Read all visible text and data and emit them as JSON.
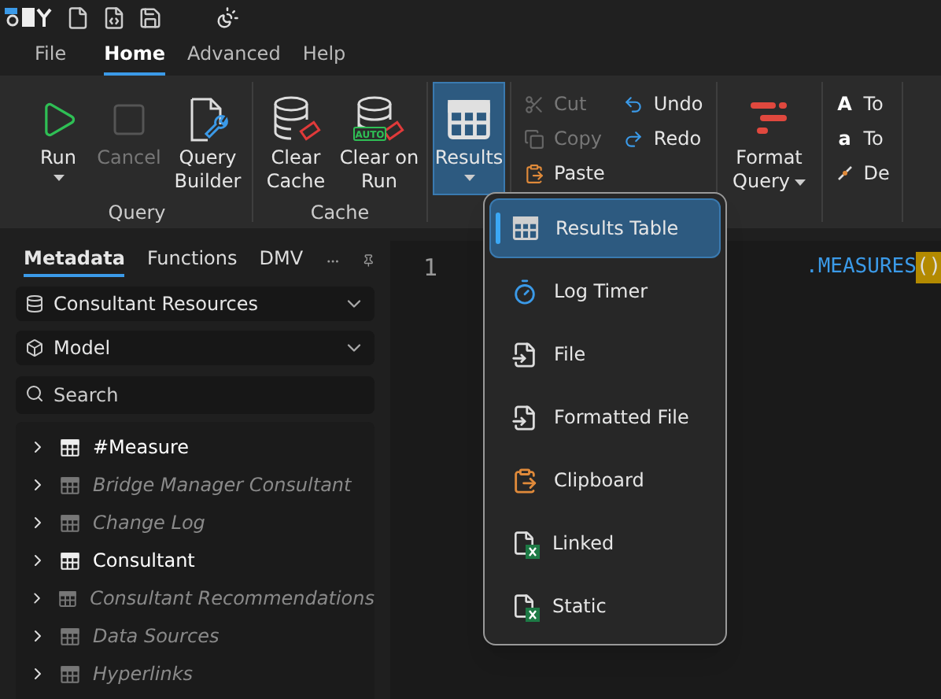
{
  "menu_tabs": [
    {
      "label": "File",
      "selected": false
    },
    {
      "label": "Home",
      "selected": true
    },
    {
      "label": "Advanced",
      "selected": false
    },
    {
      "label": "Help",
      "selected": false
    }
  ],
  "ribbon": {
    "groups": [
      {
        "label": "Query",
        "items": [
          {
            "kind": "large",
            "label": "Run",
            "dropdown": true,
            "open": false,
            "disabled": false
          },
          {
            "kind": "large",
            "label": "Cancel",
            "dropdown": false,
            "disabled": true
          },
          {
            "kind": "large",
            "label": "Query Builder",
            "dropdown": false,
            "disabled": false
          }
        ]
      },
      {
        "label": "Cache",
        "items": [
          {
            "kind": "large",
            "label": "Clear Cache",
            "dropdown": false,
            "disabled": false
          },
          {
            "kind": "large",
            "label": "Clear on Run",
            "badge": "AUTO",
            "dropdown": false,
            "disabled": false
          }
        ]
      },
      {
        "items": [
          {
            "kind": "large",
            "label": "Results",
            "dropdown": true,
            "open": true,
            "disabled": false
          }
        ]
      },
      {
        "items": [
          {
            "kind": "column",
            "buttons": [
              {
                "label": "Cut",
                "disabled": true
              },
              {
                "label": "Copy",
                "disabled": true
              },
              {
                "label": "Paste",
                "disabled": false
              }
            ]
          },
          {
            "kind": "column",
            "buttons": [
              {
                "label": "Undo",
                "disabled": false
              },
              {
                "label": "Redo",
                "disabled": false
              }
            ]
          }
        ]
      },
      {
        "items": [
          {
            "kind": "large",
            "label": "Format Query",
            "dropdown": true,
            "open": false,
            "disabled": false
          }
        ]
      },
      {
        "items": [
          {
            "kind": "column",
            "buttons": [
              {
                "glyph": "A",
                "label": "To",
                "disabled": false
              },
              {
                "glyph": "a",
                "label": "To",
                "disabled": false
              },
              {
                "label": "De",
                "disabled": false
              }
            ]
          }
        ]
      }
    ]
  },
  "side_tabs": [
    {
      "label": "Metadata",
      "selected": true
    },
    {
      "label": "Functions",
      "selected": false
    },
    {
      "label": "DMV",
      "selected": false
    }
  ],
  "database": "Consultant Resources",
  "model": "Model",
  "search": {
    "placeholder": "Search"
  },
  "tree": [
    {
      "label": "#Measure",
      "hidden": false,
      "expanded": false
    },
    {
      "label": "Bridge Manager Consultant",
      "hidden": true,
      "expanded": false
    },
    {
      "label": "Change Log",
      "hidden": true,
      "expanded": false
    },
    {
      "label": "Consultant",
      "hidden": false,
      "expanded": false
    },
    {
      "label": "Consultant Recommendations",
      "hidden": true,
      "expanded": false
    },
    {
      "label": "Data Sources",
      "hidden": true,
      "expanded": false
    },
    {
      "label": "Hyperlinks",
      "hidden": true,
      "expanded": false
    }
  ],
  "editor": {
    "lines": [
      {
        "number": "1",
        "code": ".MEASURES",
        "brackets": "()"
      }
    ]
  },
  "results_menu": {
    "items": [
      {
        "label": "Results Table",
        "selected": true
      },
      {
        "label": "Log Timer",
        "selected": false
      },
      {
        "label": "File",
        "selected": false
      },
      {
        "label": "Formatted File",
        "selected": false
      },
      {
        "label": "Clipboard",
        "selected": false
      },
      {
        "label": "Linked",
        "selected": false
      },
      {
        "label": "Static",
        "selected": false
      }
    ]
  }
}
